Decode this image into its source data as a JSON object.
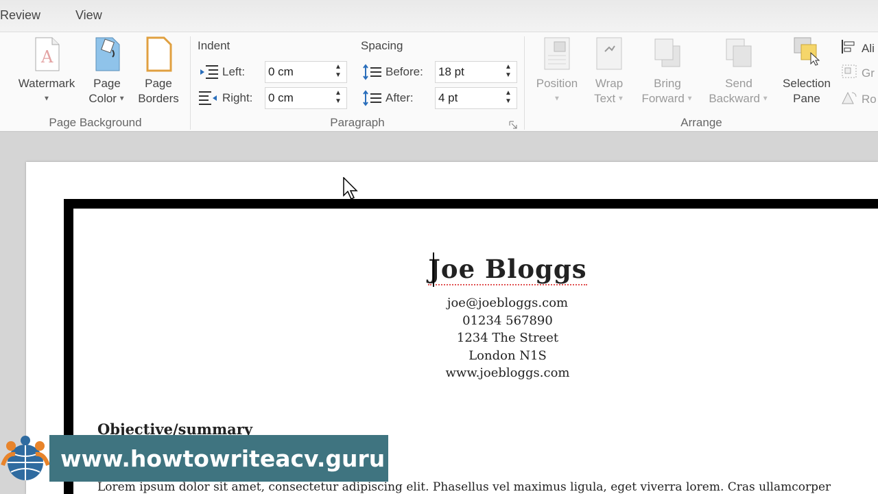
{
  "ribbon_tabs": [
    "Review",
    "View"
  ],
  "page_background": {
    "label": "Page Background",
    "watermark": "Watermark",
    "page_color": [
      "Page",
      "Color"
    ],
    "page_borders": [
      "Page",
      "Borders"
    ]
  },
  "paragraph": {
    "label": "Paragraph",
    "indent": {
      "heading": "Indent",
      "left_label": "Left:",
      "left_value": "0 cm",
      "right_label": "Right:",
      "right_value": "0 cm"
    },
    "spacing": {
      "heading": "Spacing",
      "before_label": "Before:",
      "before_value": "18 pt",
      "after_label": "After:",
      "after_value": "4 pt"
    }
  },
  "arrange": {
    "label": "Arrange",
    "position": "Position",
    "wrap_text": [
      "Wrap",
      "Text"
    ],
    "bring_forward": [
      "Bring",
      "Forward"
    ],
    "send_backward": [
      "Send",
      "Backward"
    ],
    "selection_pane": [
      "Selection",
      "Pane"
    ],
    "align": "Ali",
    "group": "Gr",
    "rotate": "Ro"
  },
  "document": {
    "name": "Joe Bloggs",
    "contact": [
      "joe@joebloggs.com",
      "01234 567890",
      "1234 The Street",
      "London N1S",
      "www.joebloggs.com"
    ],
    "section_heading": "Objective/summary",
    "body_text": "Lorem ipsum dolor sit amet, consectetur adipiscing elit. Phasellus vel maximus ligula, eget viverra lorem. Cras ullamcorper"
  },
  "banner": {
    "text": "www.howtowriteacv.guru",
    "color": "#3f7480"
  }
}
